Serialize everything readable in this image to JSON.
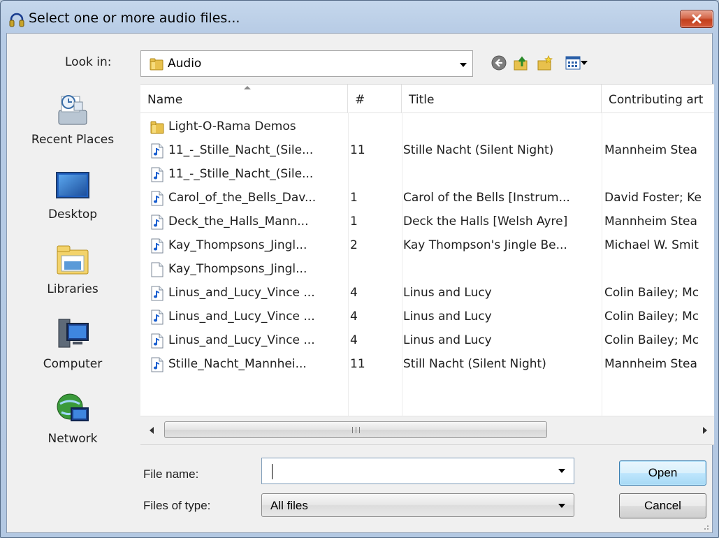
{
  "window": {
    "title": "Select one or more audio files..."
  },
  "toolbar": {
    "look_in_label": "Look in:",
    "look_in_value": "Audio"
  },
  "places": [
    {
      "label": "Recent Places",
      "icon": "recent-places-icon"
    },
    {
      "label": "Desktop",
      "icon": "desktop-icon"
    },
    {
      "label": "Libraries",
      "icon": "libraries-icon"
    },
    {
      "label": "Computer",
      "icon": "computer-icon"
    },
    {
      "label": "Network",
      "icon": "network-icon"
    }
  ],
  "list": {
    "columns": {
      "name": "Name",
      "number": "#",
      "title": "Title",
      "artist": "Contributing art"
    },
    "rows": [
      {
        "name": "Light-O-Rama Demos",
        "number": "",
        "title": "",
        "artist": "",
        "icon": "folder-icon"
      },
      {
        "name": "11_-_Stille_Nacht_(Sile...",
        "number": "11",
        "title": "Stille Nacht (Silent Night)",
        "artist": "Mannheim Stea",
        "icon": "audio-file-icon"
      },
      {
        "name": "11_-_Stille_Nacht_(Sile...",
        "number": "",
        "title": "",
        "artist": "",
        "icon": "audio-file-icon"
      },
      {
        "name": "Carol_of_the_Bells_Dav...",
        "number": "1",
        "title": "Carol of the Bells [Instrum...",
        "artist": "David Foster; Ke",
        "icon": "audio-file-icon"
      },
      {
        "name": "Deck_the_Halls_Mann...",
        "number": "1",
        "title": "Deck the Halls [Welsh Ayre]",
        "artist": "Mannheim Stea",
        "icon": "audio-file-icon"
      },
      {
        "name": "Kay_Thompsons_Jingl...",
        "number": "2",
        "title": "Kay Thompson's Jingle Be...",
        "artist": "Michael W. Smit",
        "icon": "audio-file-icon"
      },
      {
        "name": "Kay_Thompsons_Jingl...",
        "number": "",
        "title": "",
        "artist": "",
        "icon": "blank-file-icon"
      },
      {
        "name": "Linus_and_Lucy_Vince ...",
        "number": "4",
        "title": "Linus and Lucy",
        "artist": "Colin Bailey; Mc",
        "icon": "audio-file-icon"
      },
      {
        "name": "Linus_and_Lucy_Vince ...",
        "number": "4",
        "title": "Linus and Lucy",
        "artist": "Colin Bailey; Mc",
        "icon": "audio-file-icon"
      },
      {
        "name": "Linus_and_Lucy_Vince ...",
        "number": "4",
        "title": "Linus and Lucy",
        "artist": "Colin Bailey; Mc",
        "icon": "audio-file-icon"
      },
      {
        "name": "Stille_Nacht_Mannhei...",
        "number": "11",
        "title": "Still Nacht (Silent Night)",
        "artist": "Mannheim Stea",
        "icon": "audio-file-icon"
      }
    ]
  },
  "form": {
    "file_name_label": "File name:",
    "file_name_value": "",
    "files_of_type_label": "Files of type:",
    "files_of_type_value": "All files"
  },
  "buttons": {
    "open": "Open",
    "cancel": "Cancel"
  },
  "colors": {
    "frame": "#b6cbe5",
    "close_button": "#c94a2a",
    "default_button_border": "#3c7fb1"
  }
}
